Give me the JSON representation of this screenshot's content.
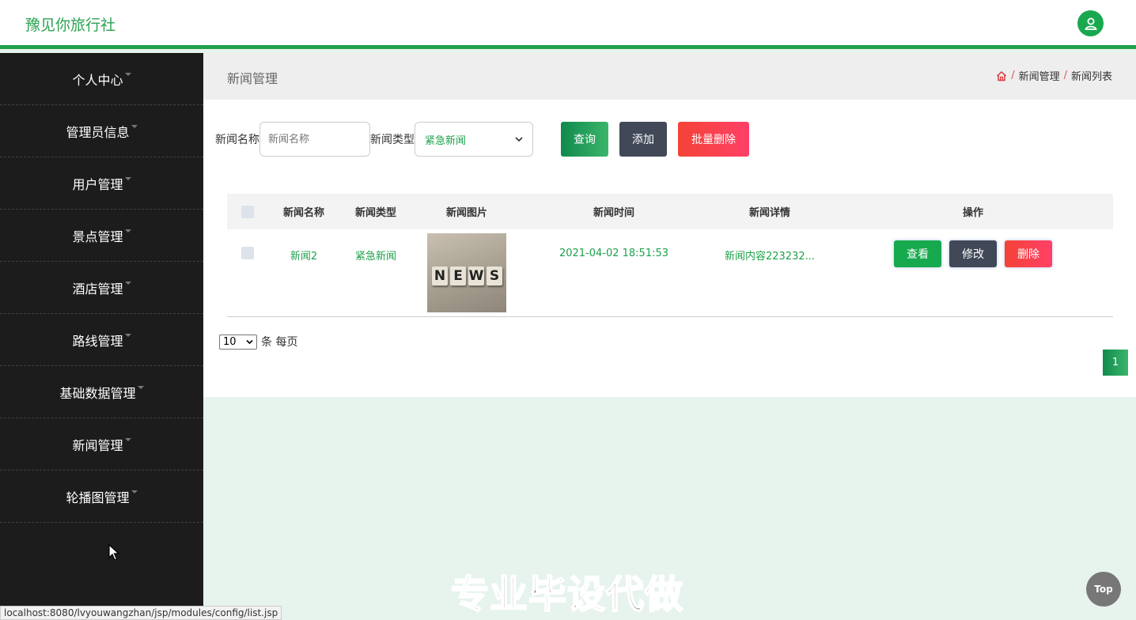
{
  "header": {
    "brand": "豫见你旅行社",
    "user_icon": "user-icon"
  },
  "sidebar": {
    "items": [
      {
        "label": "个人中心"
      },
      {
        "label": "管理员信息"
      },
      {
        "label": "用户管理"
      },
      {
        "label": "景点管理"
      },
      {
        "label": "酒店管理"
      },
      {
        "label": "路线管理"
      },
      {
        "label": "基础数据管理"
      },
      {
        "label": "新闻管理"
      },
      {
        "label": "轮播图管理"
      }
    ]
  },
  "page": {
    "title": "新闻管理",
    "breadcrumb": {
      "sep": "/",
      "level1": "新闻管理",
      "level2": "新闻列表"
    }
  },
  "filters": {
    "name_label": "新闻名称",
    "name_placeholder": "新闻名称",
    "type_label": "新闻类型",
    "type_value": "紧急新闻",
    "query": "查询",
    "add": "添加",
    "bulk_delete": "批量删除"
  },
  "table": {
    "columns": [
      "新闻名称",
      "新闻类型",
      "新闻图片",
      "新闻时间",
      "新闻详情",
      "操作"
    ],
    "rows": [
      {
        "name": "新闻2",
        "type": "紧急新闻",
        "image_text": [
          "N",
          "E",
          "W",
          "S"
        ],
        "time": "2021-04-02 18:51:53",
        "detail": "新闻内容223232...",
        "view": "查看",
        "edit": "修改",
        "delete": "删除"
      }
    ]
  },
  "pager": {
    "per_page": "10",
    "per_page_suffix": "条 每页",
    "current": "1"
  },
  "watermark": "专业毕设代做",
  "top_button": "Top",
  "status_url": "localhost:8080/lvyouwangzhan/jsp/modules/config/list.jsp",
  "colors": {
    "accent": "#1ea14b",
    "sidebar": "#1b1c1b",
    "danger": "#f44336",
    "dark": "#414858"
  }
}
